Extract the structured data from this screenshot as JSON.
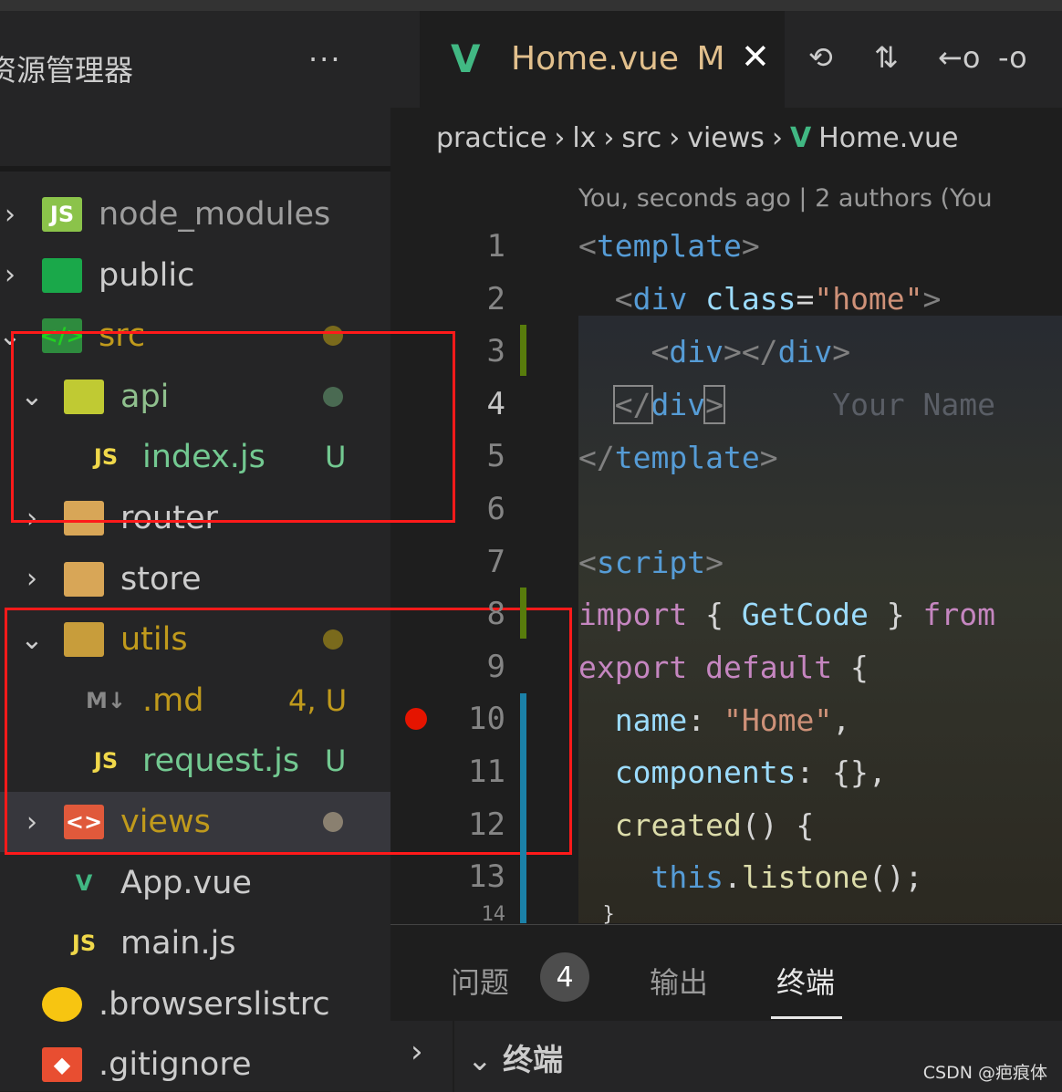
{
  "sidebar": {
    "title": "资源管理器",
    "more": "···",
    "items": [
      {
        "label": "node_modules",
        "chev": "›",
        "icon": "folder-node-icon",
        "icon_text": "JS",
        "color": "#9e9e9e",
        "badge": ""
      },
      {
        "label": "public",
        "chev": "›",
        "icon": "folder-public-icon",
        "icon_text": "",
        "color": "#cccccc",
        "badge": ""
      },
      {
        "label": "src",
        "chev": "⌄",
        "icon": "folder-src-icon",
        "icon_text": "</>",
        "color": "#c09a1c",
        "badge": ""
      },
      {
        "label": "api",
        "chev": "⌄",
        "icon": "folder-api-icon",
        "icon_text": "",
        "color": "#8fc08d",
        "badge": ""
      },
      {
        "label": "index.js",
        "chev": "",
        "icon": "js-icon",
        "icon_text": "JS",
        "color": "#73c991",
        "badge": "U"
      },
      {
        "label": "router",
        "chev": "›",
        "icon": "folder-icon",
        "icon_text": "",
        "color": "#cccccc",
        "badge": ""
      },
      {
        "label": "store",
        "chev": "›",
        "icon": "folder-icon",
        "icon_text": "",
        "color": "#cccccc",
        "badge": ""
      },
      {
        "label": "utils",
        "chev": "⌄",
        "icon": "folder-utils-icon",
        "icon_text": "",
        "color": "#c09a1c",
        "badge": ""
      },
      {
        "label": ".md",
        "chev": "",
        "icon": "markdown-icon",
        "icon_text": "M↓",
        "color": "#c09a1c",
        "badge": "4, U"
      },
      {
        "label": "request.js",
        "chev": "",
        "icon": "js-icon",
        "icon_text": "JS",
        "color": "#73c991",
        "badge": "U"
      },
      {
        "label": "views",
        "chev": "›",
        "icon": "folder-views-icon",
        "icon_text": "<>",
        "color": "#c09a1c",
        "badge": ""
      },
      {
        "label": "App.vue",
        "chev": "",
        "icon": "vue-icon",
        "icon_text": "V",
        "color": "#cccccc",
        "badge": ""
      },
      {
        "label": "main.js",
        "chev": "",
        "icon": "js-icon",
        "icon_text": "JS",
        "color": "#cccccc",
        "badge": ""
      },
      {
        "label": ".browserslistrc",
        "chev": "",
        "icon": "browserslist-icon",
        "icon_text": "",
        "color": "#cccccc",
        "badge": ""
      },
      {
        "label": ".gitignore",
        "chev": "",
        "icon": "git-icon",
        "icon_text": "◆",
        "color": "#cccccc",
        "badge": ""
      }
    ]
  },
  "tab": {
    "title": "Home.vue",
    "status": "M",
    "close": "✕"
  },
  "actions": {
    "history": "⟲",
    "compare": "⇅",
    "prev": "←o",
    "next": "-o"
  },
  "breadcrumb": [
    "practice",
    "lx",
    "src",
    "views",
    "Home.vue"
  ],
  "breadcrumb_sep": "›",
  "blame": "You, seconds ago | 2 authors (You",
  "line_numbers": [
    "1",
    "2",
    "3",
    "4",
    "5",
    "6",
    "7",
    "8",
    "9",
    "10",
    "11",
    "12",
    "13",
    "14"
  ],
  "code": {
    "l1": [
      "<",
      "template",
      ">"
    ],
    "l2": [
      "<",
      "div",
      " ",
      "class",
      "=",
      "\"home\"",
      ">"
    ],
    "l3": [
      "<",
      "div",
      "></",
      "div",
      ">"
    ],
    "l4": [
      "</",
      "div",
      ">",
      "Your Name"
    ],
    "l5": [
      "</",
      "template",
      ">"
    ],
    "l7": [
      "<",
      "script",
      ">"
    ],
    "l8": [
      "import",
      " { ",
      "GetCode",
      " } ",
      "from"
    ],
    "l9": [
      "export",
      " ",
      "default",
      " {"
    ],
    "l10": [
      "name",
      ": ",
      "\"Home\"",
      ","
    ],
    "l11": [
      "components",
      ": {},"
    ],
    "l12": [
      "created",
      "() {"
    ],
    "l13": [
      "this",
      ".",
      "listone",
      "();"
    ],
    "l14": "}"
  },
  "panel": {
    "tabs": [
      "问题",
      "输出",
      "终端"
    ],
    "problem_count": "4",
    "terminal_title": "终端",
    "chev": "›",
    "chev2": "⌄"
  },
  "watermark": "CSDN @疤痕体",
  "colors": {
    "accent": "#e2c08d",
    "untracked": "#73c991",
    "modified": "#c09a1c",
    "highlight": "#ff1a1a"
  }
}
